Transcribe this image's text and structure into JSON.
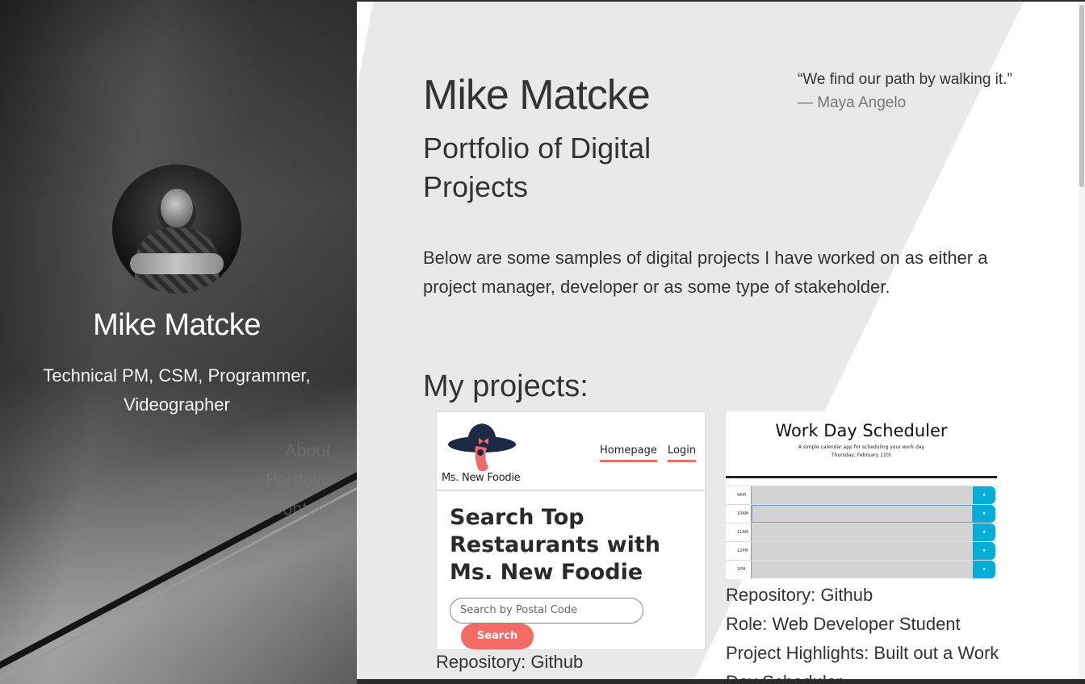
{
  "sidebar": {
    "name": "Mike Matcke",
    "title": "Technical PM, CSM, Programmer, Videographer",
    "nav": [
      {
        "label": "About"
      },
      {
        "label": "Portfolio"
      },
      {
        "label": "Contact"
      }
    ]
  },
  "header": {
    "title": "Mike Matcke",
    "subtitle": "Portfolio of Digital Projects"
  },
  "quote": {
    "text": "“We find our path by walking it.”",
    "author": "—  Maya Angelo"
  },
  "intro": "Below are some samples of digital projects I have worked on as either a project manager, developer or as some type of stakeholder.",
  "projects": {
    "heading": "My projects:",
    "foodie": {
      "brand": "Ms. New Foodie",
      "nav_home": "Homepage",
      "nav_login": "Login",
      "hero": "Search Top Restaurants with Ms. New Foodie",
      "search_placeholder": "Search by Postal Code",
      "search_button": "Search",
      "caption_repository": "Repository: Github"
    },
    "scheduler": {
      "title": "Work Day Scheduler",
      "subtitle": "A simple calendar app for scheduling your work day",
      "date": "Thursday, February 11th",
      "hours": [
        "9AM",
        "10AM",
        "11AM",
        "12PM",
        "1PM"
      ],
      "save_icon": "lock-icon",
      "caption_repository": "Repository: Github",
      "caption_role": "Role: Web Developer Student",
      "caption_highlights": "Project Highlights: Built out a Work Day Scheduler"
    }
  },
  "colors": {
    "accent_coral": "#f46a66",
    "scheduler_blue": "#06aed5",
    "panel_gray": "#e9e9e9"
  }
}
